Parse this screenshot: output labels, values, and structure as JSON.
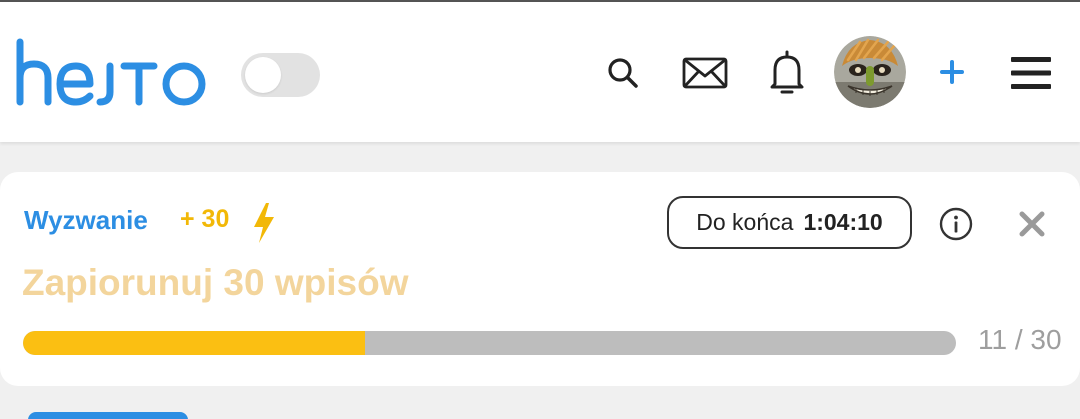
{
  "header": {
    "logo_text": "hejto",
    "brand_color": "#2c8ee3",
    "theme_toggle_on": false,
    "icons": [
      "search-icon",
      "mail-icon",
      "bell-icon",
      "avatar",
      "plus-icon",
      "menu-icon"
    ]
  },
  "challenge": {
    "label": "Wyzwanie",
    "points": "+ 30",
    "points_icon": "bolt-icon",
    "timer_label": "Do końca",
    "timer_value": "1:04:10",
    "title": "Zapiorunuj 30 wpisów",
    "progress_current": 11,
    "progress_total": 30,
    "progress_text": "11 / 30",
    "accent_color": "#f2b807",
    "title_color": "#f3d59c"
  }
}
